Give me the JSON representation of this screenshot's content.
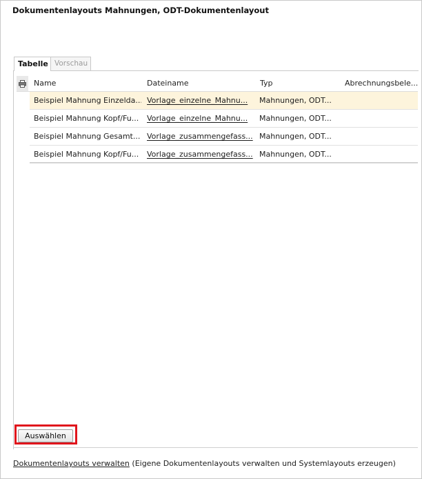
{
  "page": {
    "title": "Dokumentenlayouts Mahnungen, ODT-Dokumentenlayout"
  },
  "tabs": [
    {
      "label": "Tabelle",
      "active": true
    },
    {
      "label": "Vorschau",
      "active": false
    }
  ],
  "table": {
    "headers": [
      "Name",
      "Dateiname",
      "Typ",
      "Abrechnungsbele..."
    ],
    "rows": [
      {
        "name": "Beispiel Mahnung Einzelda...",
        "file": "Vorlage_einzelne_Mahnu...",
        "typ": "Mahnungen, ODT...",
        "abr": "",
        "selected": true
      },
      {
        "name": "Beispiel Mahnung Kopf/Fu...",
        "file": "Vorlage_einzelne_Mahnu...",
        "typ": "Mahnungen, ODT...",
        "abr": "",
        "selected": false
      },
      {
        "name": "Beispiel Mahnung Gesamt...",
        "file": "Vorlage_zusammengefass...",
        "typ": "Mahnungen, ODT...",
        "abr": "",
        "selected": false
      },
      {
        "name": "Beispiel Mahnung Kopf/Fu...",
        "file": "Vorlage_zusammengefass...",
        "typ": "Mahnungen, ODT...",
        "abr": "",
        "selected": false
      }
    ]
  },
  "actions": {
    "select_label": "Auswählen"
  },
  "footer": {
    "link_label": "Dokumentenlayouts verwalten",
    "note": "(Eigene Dokumentenlayouts verwalten und Systemlayouts erzeugen)"
  },
  "colors": {
    "selected_row": "#fdf4dc",
    "highlight": "#e0141c"
  },
  "icons": {
    "print": "printer-icon"
  }
}
